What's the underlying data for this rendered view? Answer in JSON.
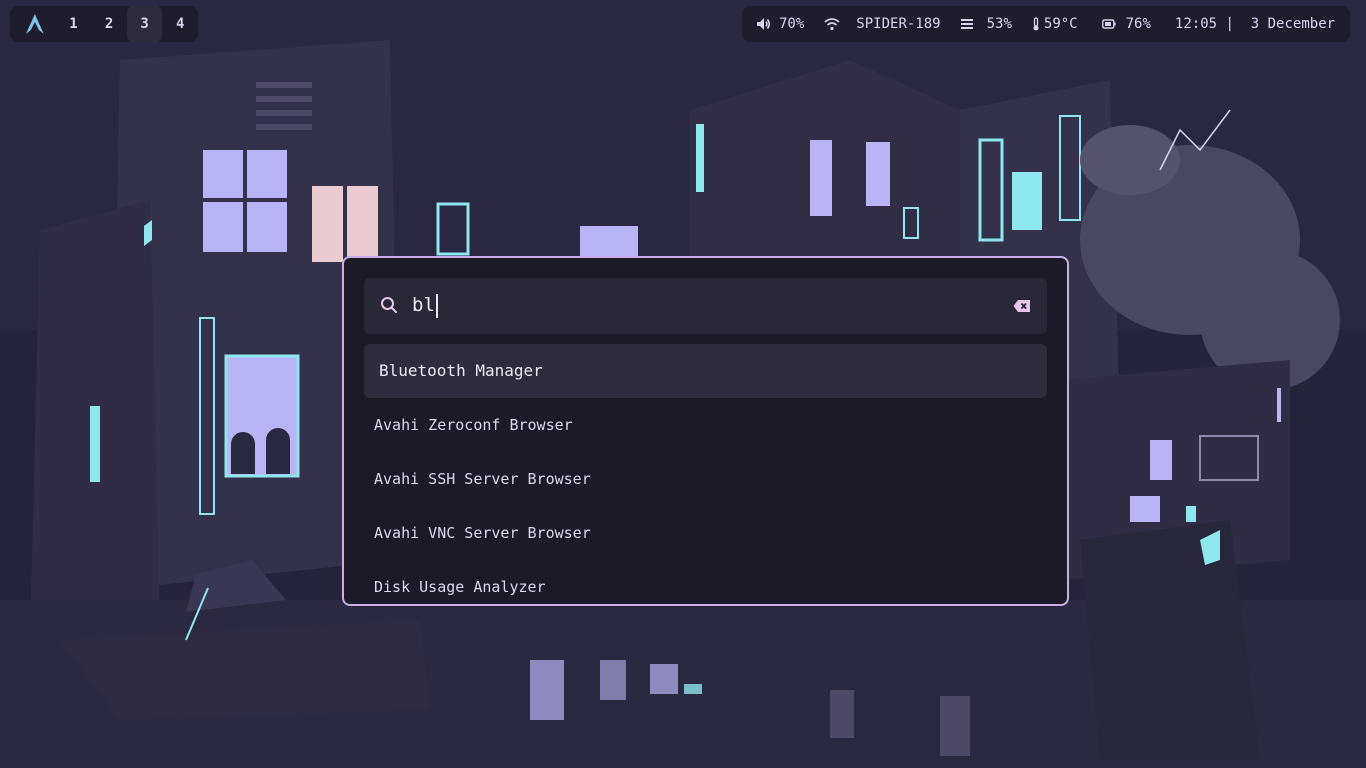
{
  "topbar": {
    "workspaces": [
      "1",
      "2",
      "3",
      "4"
    ],
    "active_workspace": "3",
    "status": {
      "volume": "70%",
      "network": "SPIDER-189",
      "memory": "53%",
      "temperature": "59°C",
      "battery": "76%",
      "clock": "12:05 |  3 December"
    }
  },
  "launcher": {
    "query": "bl",
    "results": [
      "Bluetooth Manager",
      "Avahi Zeroconf Browser",
      "Avahi SSH Server Browser",
      "Avahi VNC Server Browser",
      "Disk Usage Analyzer"
    ],
    "selected_index": 0
  },
  "colors": {
    "accent_border": "#c9aee6",
    "panel_bg": "#1f1d2b",
    "launcher_bg": "#1b1a26",
    "neon_cyan": "#8ee6ee",
    "window_lilac": "#b9b4f5"
  },
  "icons": [
    "arch-logo-icon",
    "volume-icon",
    "wifi-icon",
    "memory-icon",
    "thermometer-icon",
    "battery-icon",
    "search-icon",
    "clear-input-icon"
  ]
}
